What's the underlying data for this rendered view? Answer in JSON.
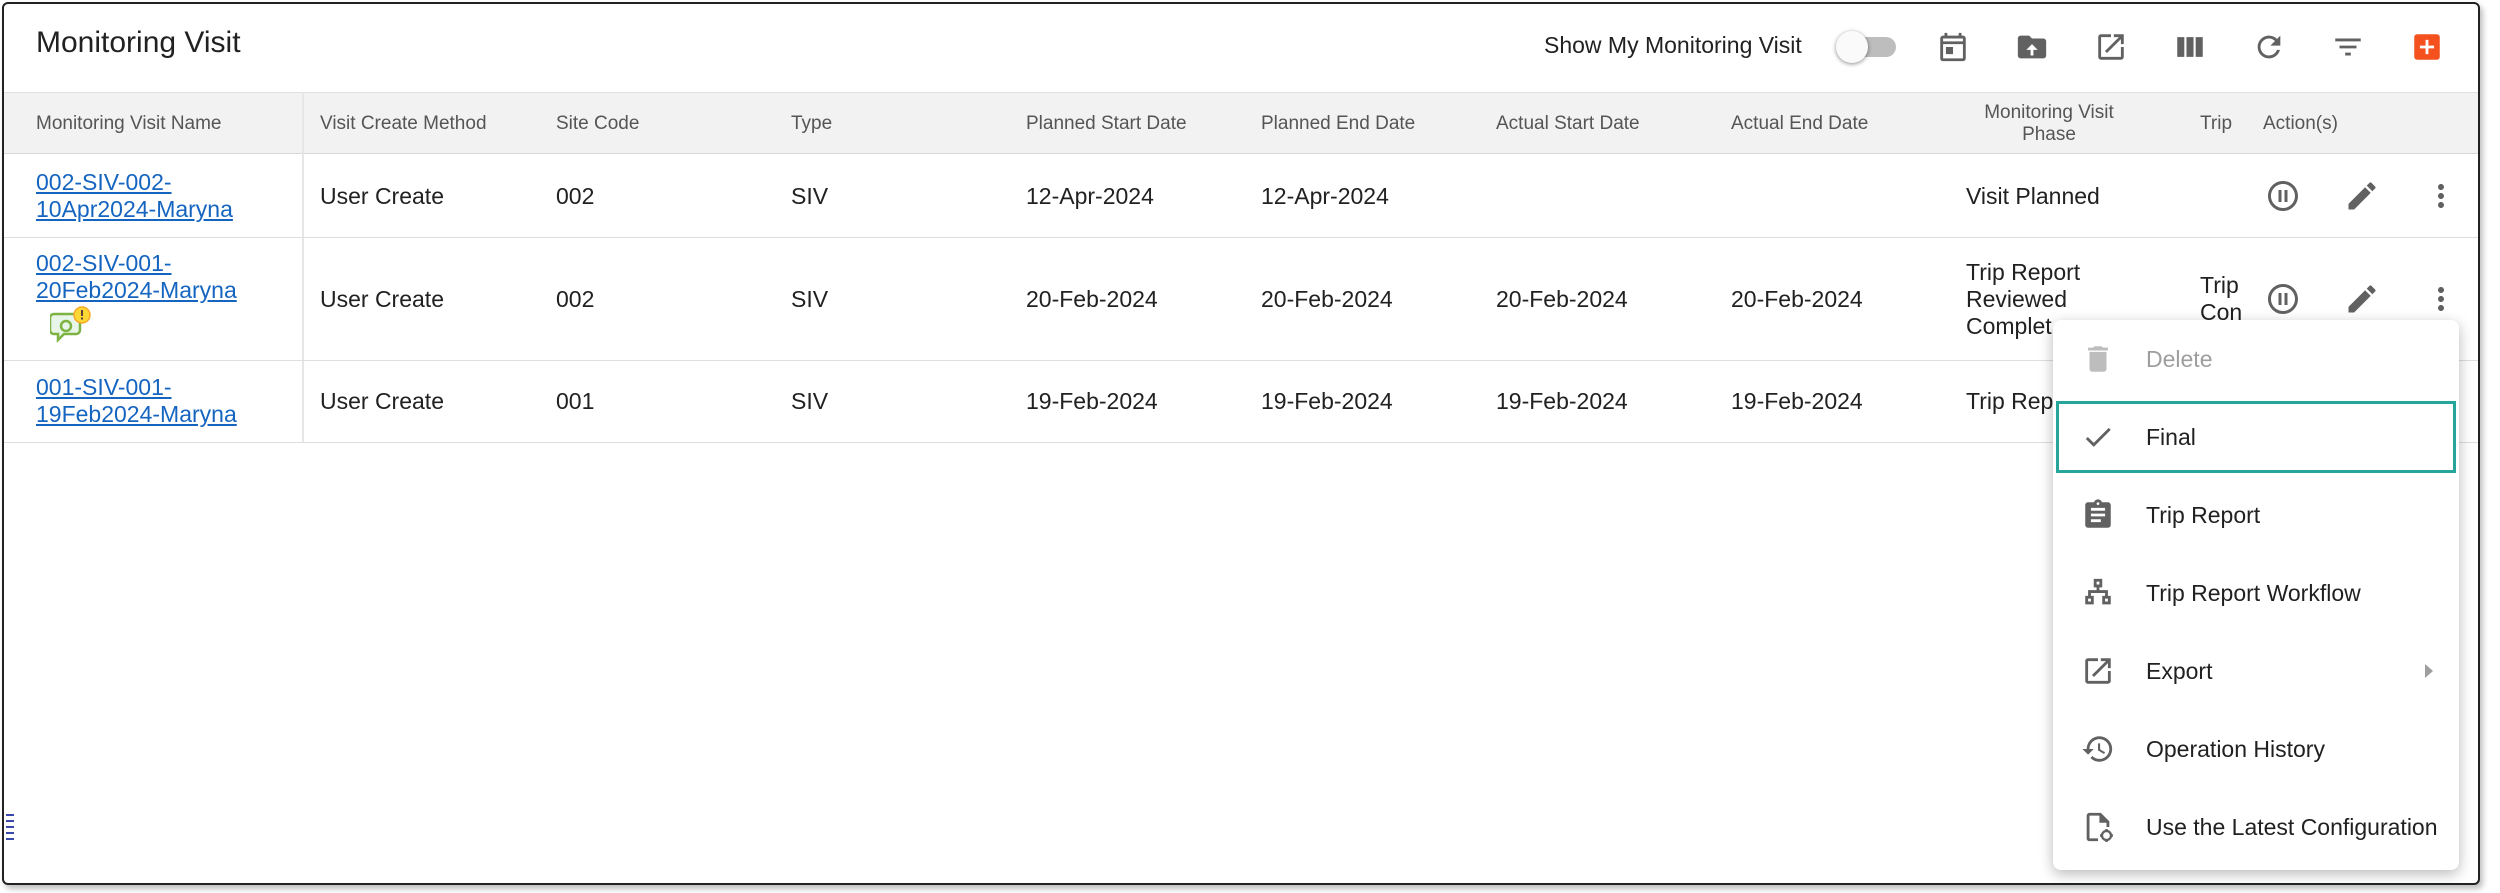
{
  "page": {
    "title": "Monitoring Visit"
  },
  "toolbar": {
    "show_my_label": "Show My Monitoring Visit",
    "show_my_enabled": false,
    "icons": [
      "calendar-icon",
      "upload-icon",
      "export-icon",
      "columns-icon",
      "refresh-icon",
      "filter-icon",
      "add-icon"
    ],
    "add_color": "#f4511e"
  },
  "table": {
    "headers": {
      "name": "Monitoring Visit Name",
      "method": "Visit Create Method",
      "site": "Site Code",
      "type": "Type",
      "pstart": "Planned Start Date",
      "pend": "Planned End Date",
      "astart": "Actual Start Date",
      "aend": "Actual End Date",
      "phase": "Monitoring Visit Phase",
      "trip": "Trip",
      "actions": "Action(s)"
    },
    "rows": [
      {
        "name": "002-SIV-002-10Apr2024-Maryna",
        "method": "User Create",
        "site": "002",
        "type": "SIV",
        "pstart": "12-Apr-2024",
        "pend": "12-Apr-2024",
        "astart": "",
        "aend": "",
        "phase": "Visit Planned",
        "trip": ""
      },
      {
        "name": "002-SIV-001-20Feb2024-Maryna",
        "method": "User Create",
        "site": "002",
        "type": "SIV",
        "pstart": "20-Feb-2024",
        "pend": "20-Feb-2024",
        "astart": "20-Feb-2024",
        "aend": "20-Feb-2024",
        "phase": "Trip Report Reviewed Complet...",
        "trip": "Trip Con"
      },
      {
        "name": "001-SIV-001-19Feb2024-Maryna",
        "method": "User Create",
        "site": "001",
        "type": "SIV",
        "pstart": "19-Feb-2024",
        "pend": "19-Feb-2024",
        "astart": "19-Feb-2024",
        "aend": "19-Feb-2024",
        "phase": "Trip Repo",
        "trip": ""
      }
    ]
  },
  "menu": {
    "items": [
      {
        "label": "Delete",
        "icon": "delete-icon",
        "disabled": true
      },
      {
        "label": "Final",
        "icon": "check-icon",
        "selected": true
      },
      {
        "label": "Trip Report",
        "icon": "clipboard-icon"
      },
      {
        "label": "Trip Report Workflow",
        "icon": "workflow-icon"
      },
      {
        "label": "Export",
        "icon": "export-icon",
        "has_submenu": true
      },
      {
        "label": "Operation History",
        "icon": "history-icon"
      },
      {
        "label": "Use the Latest Configuration",
        "icon": "config-file-icon"
      }
    ],
    "highlight_color": "#26a69a"
  }
}
